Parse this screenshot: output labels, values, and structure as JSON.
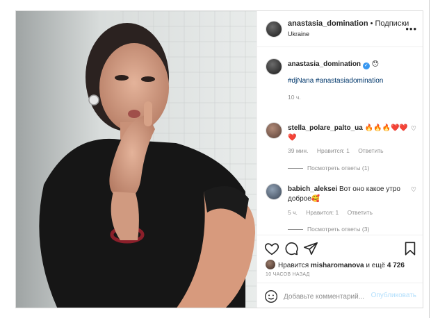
{
  "post": {
    "author": "anastasia_domination",
    "follow_sep": " • ",
    "follow_label": "Подписки",
    "location": "Ukraine",
    "more_icon": "more-dots-icon"
  },
  "caption": {
    "author": "anastasia_domination",
    "verified_icon": "verified-badge-icon",
    "emoji": "😯",
    "hashtags": "#djNana #anastasiadomination",
    "time": "10 ч."
  },
  "comments": [
    {
      "user": "stella_polare_palto_ua",
      "text": "🔥🔥🔥❤️❤️❤️",
      "time": "39 мин.",
      "likes": "Нравится: 1",
      "reply": "Ответить",
      "view_replies": "Посмотреть ответы (1)"
    },
    {
      "user": "babich_aleksei",
      "text": "Вот оно какое утро доброе🥰",
      "time": "5 ч.",
      "likes": "Нравится: 1",
      "reply": "Ответить",
      "view_replies": "Посмотреть ответы (3)"
    }
  ],
  "actions": {
    "like_icon": "heart-icon",
    "comment_icon": "comment-icon",
    "share_icon": "paper-plane-icon",
    "save_icon": "bookmark-icon"
  },
  "likes": {
    "prefix": "Нравится",
    "user": "misharomanova",
    "suffix": "и ещё",
    "count": "4 726"
  },
  "time_ago": "10 ЧАСОВ НАЗАД",
  "add_comment": {
    "placeholder": "Добавьте комментарий...",
    "post_label": "Опубликовать",
    "emoji_icon": "smile-icon"
  },
  "colors": {
    "border": "#dbdbdb",
    "muted": "#8e8e8e",
    "link": "#00376b",
    "verified": "#3897f0",
    "post_button_disabled": "#b2dffc"
  }
}
